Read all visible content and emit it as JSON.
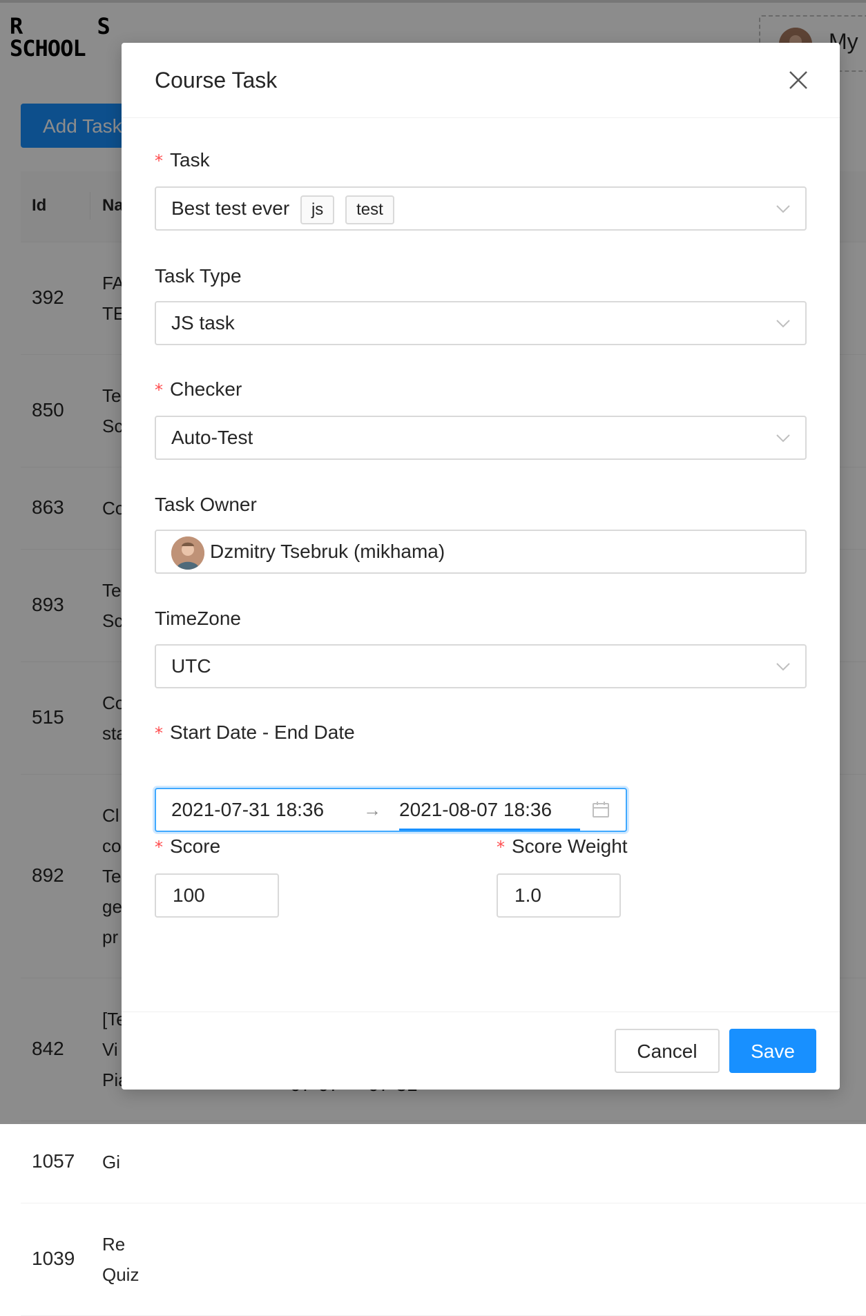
{
  "app": {
    "logo_line1": "R S",
    "logo_line2": "SCHOOL",
    "user_label": "My",
    "add_task_label": "Add Task"
  },
  "table": {
    "headers": [
      "Id",
      "Na"
    ],
    "rows": [
      {
        "id": "392",
        "name_lines": [
          "FA",
          "TE"
        ]
      },
      {
        "id": "850",
        "name_lines": [
          "Te",
          "Sc"
        ]
      },
      {
        "id": "863",
        "name_lines": [
          "Co"
        ]
      },
      {
        "id": "893",
        "name_lines": [
          "Te",
          "Sc"
        ]
      },
      {
        "id": "515",
        "name_lines": [
          "Co",
          "sta"
        ]
      },
      {
        "id": "892",
        "name_lines": [
          "Cl",
          "co",
          "Te",
          "ge",
          "pr"
        ]
      },
      {
        "id": "842",
        "name_lines": [
          "[Te",
          "Vi",
          "Pia"
        ]
      },
      {
        "id": "1057",
        "name_lines": [
          "Gi"
        ]
      },
      {
        "id": "1039",
        "name_lines": [
          "Re",
          "Quiz"
        ]
      }
    ],
    "tail_dates": [
      "07-07",
      "07-31"
    ]
  },
  "modal": {
    "title": "Course Task",
    "close_icon": "close-icon",
    "task": {
      "label": "Task",
      "required": true,
      "value": "Best test ever",
      "tags": [
        "js",
        "test"
      ]
    },
    "task_type": {
      "label": "Task Type",
      "value": "JS task"
    },
    "checker": {
      "label": "Checker",
      "required": true,
      "value": "Auto-Test"
    },
    "task_owner": {
      "label": "Task Owner",
      "value": "Dzmitry Tsebruk (mikhama)"
    },
    "timezone": {
      "label": "TimeZone",
      "value": "UTC"
    },
    "dates": {
      "label": "Start Date - End Date",
      "required": true,
      "start": "2021-07-31 18:36",
      "arrow": "→",
      "end": "2021-08-07 18:36"
    },
    "score": {
      "label": "Score",
      "required": true,
      "value": "100"
    },
    "score_weight": {
      "label": "Score Weight",
      "required": true,
      "value": "1.0"
    },
    "footer": {
      "cancel_label": "Cancel",
      "save_label": "Save"
    }
  },
  "colors": {
    "primary": "#1890ff",
    "required": "#ff4d4f",
    "border": "#d9d9d9",
    "overlay": "rgba(0,0,0,0.45)"
  }
}
